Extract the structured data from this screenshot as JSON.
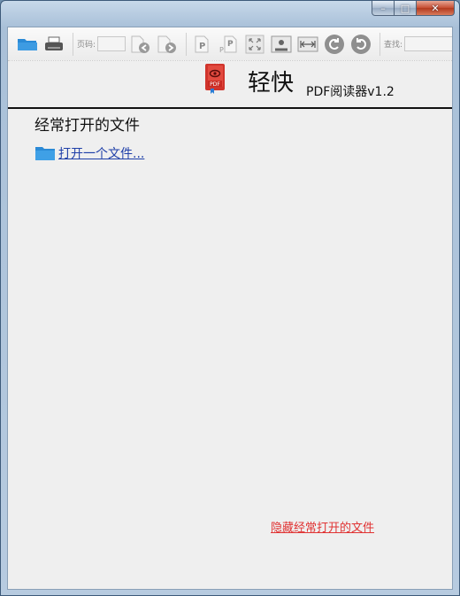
{
  "titlebar": {
    "minimize_glyph": "–",
    "maximize_glyph": "□",
    "close_glyph": "✕"
  },
  "toolbar": {
    "page_label": "页码:",
    "page_value": "",
    "search_label": "查找:",
    "search_value": ""
  },
  "header": {
    "app_name": "轻快",
    "app_subtitle": "PDF阅读器v1.2",
    "logo_text": "PDF"
  },
  "recent": {
    "title": "经常打开的文件",
    "open_file_label": "打开一个文件..."
  },
  "footer": {
    "hide_recent_label": "隐藏经常打开的文件"
  },
  "colors": {
    "link_blue": "#1f3fa8",
    "hide_link_red": "#e03333",
    "logo_red": "#d0342c",
    "folder_blue": "#2a8ad6"
  }
}
